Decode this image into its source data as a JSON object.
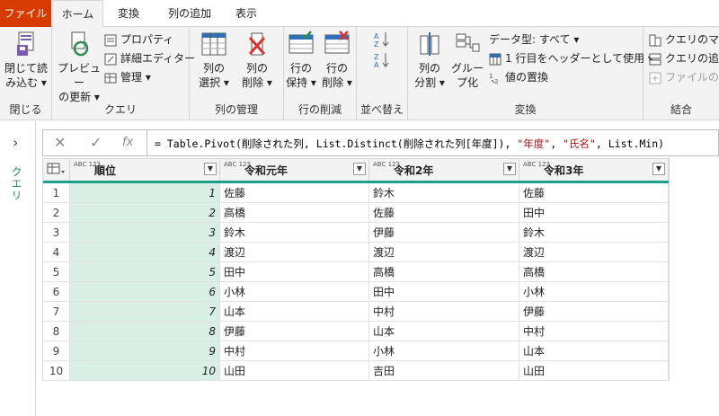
{
  "tabs": [
    {
      "label": "ファイル"
    },
    {
      "label": "ホーム"
    },
    {
      "label": "変換"
    },
    {
      "label": "列の追加"
    },
    {
      "label": "表示"
    }
  ],
  "ribbon": {
    "close": {
      "btn1": "閉じて読",
      "btn1b": "み込む ▾",
      "group": "閉じる"
    },
    "query": {
      "preview1": "プレビュー",
      "preview2": "の更新 ▾",
      "properties": "プロパティ",
      "advanced": "詳細エディター",
      "manage": "管理 ▾",
      "group": "クエリ"
    },
    "columns": {
      "select1": "列の",
      "select2": "選択 ▾",
      "remove1": "列の",
      "remove2": "削除 ▾",
      "group": "列の管理"
    },
    "rows": {
      "keep1": "行の",
      "keep2": "保持 ▾",
      "remove1": "行の",
      "remove2": "削除 ▾",
      "group": "行の削減"
    },
    "sort": {
      "group": "並べ替え"
    },
    "transform": {
      "split1": "列の",
      "split2": "分割 ▾",
      "group1": "グルー",
      "group2": "プ化",
      "datatype": "データ型: すべて ▾",
      "header": "1 行目をヘッダーとして使用 ▾",
      "replace": "値の置換",
      "group": "変換"
    },
    "combine": {
      "merge": "クエリのマージ",
      "append": "クエリの追加",
      "files": "ファイルの結合",
      "group": "結合"
    }
  },
  "leftpane": {
    "label": "クエリ"
  },
  "formula": {
    "prefix": "= Table.Pivot(削除された列, List.Distinct(削除された列[年度]), ",
    "s1": "\"年度\"",
    "comma": ", ",
    "s2": "\"氏名\"",
    "suffix": ", List.Min)"
  },
  "table": {
    "type_label": "ABC 123",
    "columns": [
      "順位",
      "令和元年",
      "令和2年",
      "令和3年"
    ],
    "rows": [
      {
        "n": "1",
        "rank": "1",
        "c1": "佐藤",
        "c2": "鈴木",
        "c3": "佐藤"
      },
      {
        "n": "2",
        "rank": "2",
        "c1": "高橋",
        "c2": "佐藤",
        "c3": "田中"
      },
      {
        "n": "3",
        "rank": "3",
        "c1": "鈴木",
        "c2": "伊藤",
        "c3": "鈴木"
      },
      {
        "n": "4",
        "rank": "4",
        "c1": "渡辺",
        "c2": "渡辺",
        "c3": "渡辺"
      },
      {
        "n": "5",
        "rank": "5",
        "c1": "田中",
        "c2": "高橋",
        "c3": "高橋"
      },
      {
        "n": "6",
        "rank": "6",
        "c1": "小林",
        "c2": "田中",
        "c3": "小林"
      },
      {
        "n": "7",
        "rank": "7",
        "c1": "山本",
        "c2": "中村",
        "c3": "伊藤"
      },
      {
        "n": "8",
        "rank": "8",
        "c1": "伊藤",
        "c2": "山本",
        "c3": "中村"
      },
      {
        "n": "9",
        "rank": "9",
        "c1": "中村",
        "c2": "小林",
        "c3": "山本"
      },
      {
        "n": "10",
        "rank": "10",
        "c1": "山田",
        "c2": "吉田",
        "c3": "山田"
      }
    ]
  },
  "colors": {
    "file_tab": "#d83b01",
    "accent": "#1ea088",
    "rank_bg": "#d9efe6",
    "string": "#a31515"
  }
}
